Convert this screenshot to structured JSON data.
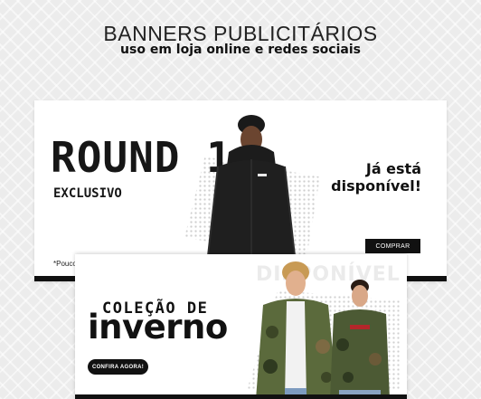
{
  "header": {
    "title": "BANNERS PUBLICITÁRIOS",
    "subtitle": "uso em loja online e redes sociais"
  },
  "banner_round": {
    "title": "ROUND 1",
    "subtitle": "EXCLUSIVO",
    "availability_line1": "Já está",
    "availability_line2": "disponível!",
    "button_label": "COMPRAR",
    "fineprint": "*Pouco"
  },
  "banner_inverno": {
    "watermark": "DISPONÍVEL",
    "line1": "COLEÇÃO DE",
    "line2": "inverno",
    "button_label": "CONFIRA AGORA!"
  }
}
